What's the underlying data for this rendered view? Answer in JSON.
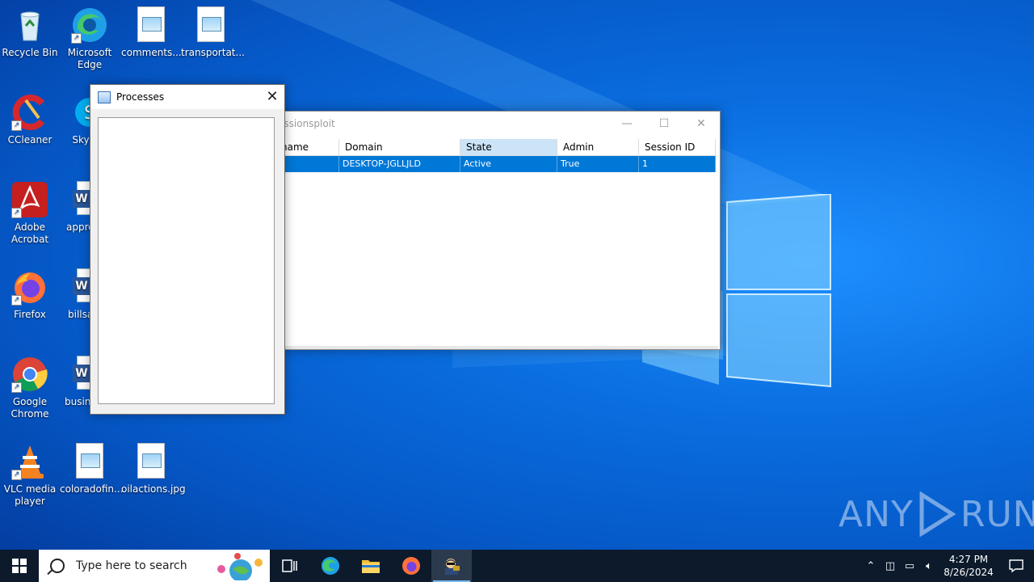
{
  "desktop": {
    "icons": [
      {
        "label": "Recycle Bin"
      },
      {
        "label": "Microsoft Edge"
      },
      {
        "label": "comments..."
      },
      {
        "label": "transportat..."
      },
      {
        "label": "CCleaner"
      },
      {
        "label": "Sky"
      },
      {
        "label": "Adobe Acrobat"
      },
      {
        "label": "appro"
      },
      {
        "label": "Firefox"
      },
      {
        "label": "billsa"
      },
      {
        "label": "Google Chrome"
      },
      {
        "label": "busine"
      },
      {
        "label": "VLC media player"
      },
      {
        "label": "coloradofin..."
      },
      {
        "label": "oilactions.jpg"
      }
    ]
  },
  "processes_window": {
    "title": "Processes",
    "close_glyph": "✕"
  },
  "session_window": {
    "title": "essionsploit",
    "columns": [
      "name",
      "Domain",
      "State",
      "Admin",
      "Session ID"
    ],
    "rows": [
      {
        "name": "",
        "domain": "DESKTOP-JGLLJLD",
        "state": "Active",
        "admin": "True",
        "session_id": "1"
      }
    ]
  },
  "watermark": {
    "left": "ANY",
    "right": "RUN"
  },
  "taskbar": {
    "search_placeholder": "Type here to search",
    "time": "4:27 PM",
    "date": "8/26/2024",
    "apps": [
      "task-view-icon",
      "edge-icon",
      "file-explorer-icon",
      "firefox-icon",
      "hacker-app-icon"
    ]
  },
  "colors": {
    "accent": "#0078d7",
    "selected_header": "#cce4f7",
    "taskbar": "#0c1a2c"
  }
}
